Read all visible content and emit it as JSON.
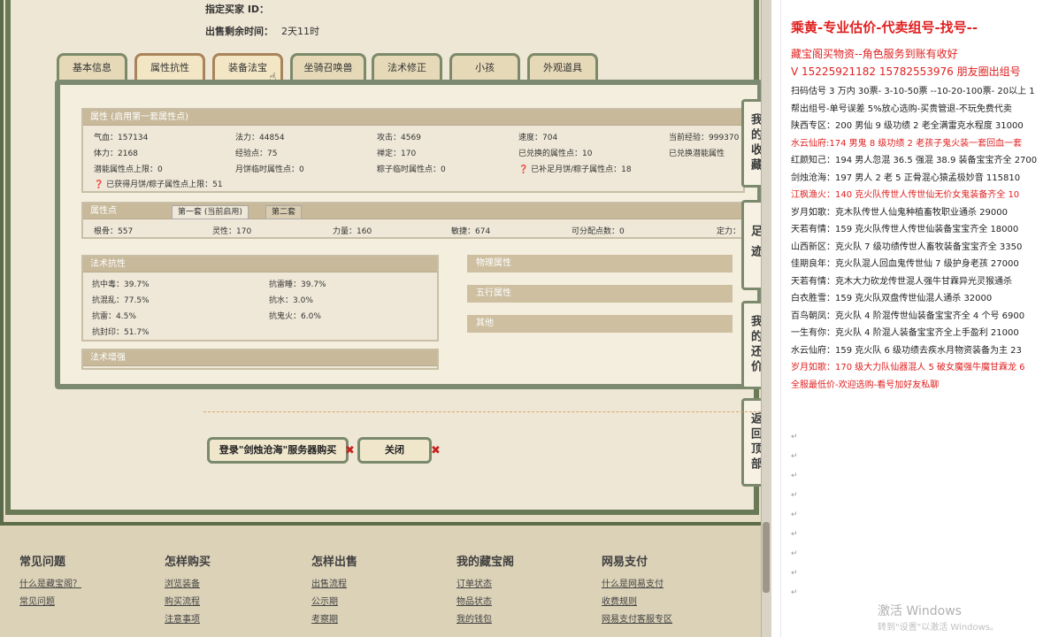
{
  "left": {
    "buyer": {
      "label": "指定买家 ID：",
      "value": ""
    },
    "remaining": {
      "label": "出售剩余时间：",
      "value": "2天11时"
    },
    "tabs": [
      "基本信息",
      "属性抗性",
      "装备法宝",
      "坐骑召唤兽",
      "法术修正",
      "小孩",
      "外观道具"
    ],
    "attr": {
      "title": "属性 (启用第一套属性点)",
      "rows": [
        [
          "气血：157134",
          "法力：44854",
          "攻击：4569",
          "速度：704",
          "当前经验：999370"
        ],
        [
          "体力：2168",
          "经验点：75",
          "禅定：170",
          "已兑换的属性点：10",
          "已兑换潜能属性"
        ],
        [
          "潜能属性点上限：0",
          "月饼临时属性点：0",
          "粽子临时属性点：0",
          "已补足月饼/粽子属性点：18"
        ]
      ],
      "extra": "已获得月饼/粽子属性点上限：51"
    },
    "points": {
      "title": "属性点",
      "tab1": "第一套 (当前启用)",
      "tab2": "第二套",
      "values": [
        "根骨：557",
        "灵性：170",
        "力量：160",
        "敏捷：674",
        "可分配点数：0",
        "定力："
      ]
    },
    "resist": {
      "title": "法术抗性",
      "left": [
        "抗中毒：39.7%",
        "抗混乱：77.5%",
        "抗雷：4.5%",
        "抗封印：51.7%"
      ],
      "right": [
        "抗雷睡：39.7%",
        "抗水：3.0%",
        "抗鬼火：6.0%"
      ]
    },
    "enhance": {
      "title": "法术增强"
    },
    "accordions": [
      "物理属性",
      "五行属性",
      "其他"
    ],
    "side_buttons": [
      "我的收藏",
      "足迹",
      "我的还价",
      "返回顶部"
    ],
    "login_button": "登录\"剑烛沧海\"服务器购买",
    "close_button": "关闭",
    "footer": [
      {
        "head": "常见问题",
        "links": [
          "什么是藏宝阁？",
          "常见问题"
        ]
      },
      {
        "head": "怎样购买",
        "links": [
          "浏览装备",
          "购买流程",
          "注意事项"
        ]
      },
      {
        "head": "怎样出售",
        "links": [
          "出售流程",
          "公示期",
          "考察期"
        ]
      },
      {
        "head": "我的藏宝阁",
        "links": [
          "订单状态",
          "物品状态",
          "我的钱包"
        ]
      },
      {
        "head": "网易支付",
        "links": [
          "什么是网易支付",
          "收费规则",
          "网易支付客服专区"
        ]
      }
    ]
  },
  "right": {
    "title": "乘黄-专业估价-代卖组号-找号--",
    "sub1": "藏宝阁买物资--角色服务到账有收好",
    "sub2": "V 15225921182 15782553976 朋友圈出组号",
    "lines": [
      {
        "t": "扫码估号 3 万内 30票- 3-10-50票 --10-20-100票- 20以上 1",
        "red": false
      },
      {
        "t": "帮出组号-单号误差 5%放心选购-买贵管退-不玩免费代卖",
        "red": false
      },
      {
        "t": "陕西专区：200 男仙 9 级功绩 2 老全满雷克水程度 31000",
        "red": false
      },
      {
        "t": "水云仙府:174 男鬼 8 级功绩 2 老孩子鬼火装一套回血一套",
        "red": true
      },
      {
        "t": "红颜知己：194 男人忽混 36.5 强混 38.9 装备宝宝齐全 2700",
        "red": false
      },
      {
        "t": "剑烛沧海：197 男人 2 老 5 正骨混心猿孟极妙音 115810",
        "red": false
      },
      {
        "t": "江枫渔火：140 克火队传世人传世仙无价女鬼装备齐全 10",
        "red": true
      },
      {
        "t": "岁月如歌：克木队传世人仙鬼种植畜牧职业通杀 29000",
        "red": false
      },
      {
        "t": "天若有情：159 克火队传世人传世仙装备宝宝齐全 18000",
        "red": false
      },
      {
        "t": "山西新区：克火队 7 级功绩传世人畜牧装备宝宝齐全 3350",
        "red": false
      },
      {
        "t": "佳期良年：克火队混人回血鬼传世仙 7 级护身老孩 27000",
        "red": false
      },
      {
        "t": "天若有情：克木大力砍龙传世混人强牛甘霖异光灵猴通杀",
        "red": false
      },
      {
        "t": "白衣胜雪：159 克火队双盘传世仙混人通杀 32000",
        "red": false
      },
      {
        "t": "百鸟朝凤：克火队 4 阶混传世仙装备宝宝齐全 4 个号 6900",
        "red": false
      },
      {
        "t": "一生有你：克火队 4 阶混人装备宝宝齐全上手盈利 21000",
        "red": false
      },
      {
        "t": "水云仙府：159 克火队 6 级功绩去疾水月物资装备为主 23",
        "red": false
      },
      {
        "t": "岁月如歌：170 级大力队仙器混人 5 破女魔强牛魔甘霖龙 6",
        "red": true
      },
      {
        "t": "全服最低价-欢迎选购-看号加好友私聊",
        "red": true
      }
    ],
    "watermark1": "激活 Windows",
    "watermark2": "转到\"设置\"以激活 Windows。"
  }
}
